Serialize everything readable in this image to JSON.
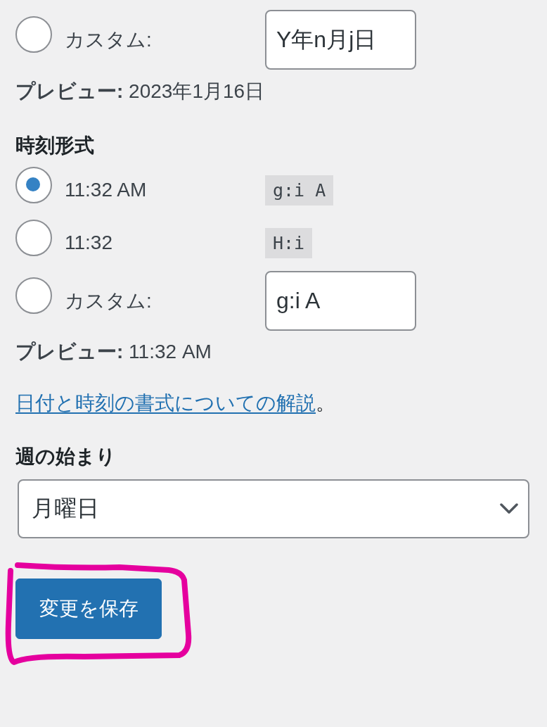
{
  "date_format": {
    "options": [
      {
        "kind": "custom",
        "label": "カスタム:",
        "selected": false,
        "value": "Y年n月j日"
      }
    ],
    "preview": "**プレビュー:** 2023年1月16日"
  },
  "time_format": {
    "heading": "時刻形式",
    "options": [
      {
        "kind": "preset",
        "label": "11:32 AM",
        "selected": true,
        "code": "g:i A"
      },
      {
        "kind": "preset",
        "label": "11:32",
        "selected": false,
        "code": "H:i"
      },
      {
        "kind": "custom",
        "label": "カスタム:",
        "selected": false,
        "value": "g:i A"
      }
    ],
    "preview": "**プレビュー:** 11:32 AM"
  },
  "help": {
    "link": "日付と時刻の書式についての解説",
    "suffix": "。"
  },
  "week_start": {
    "heading": "週の始まり",
    "value": "月曜日"
  },
  "save_button": {
    "label": "変更を保存",
    "circled": true
  }
}
